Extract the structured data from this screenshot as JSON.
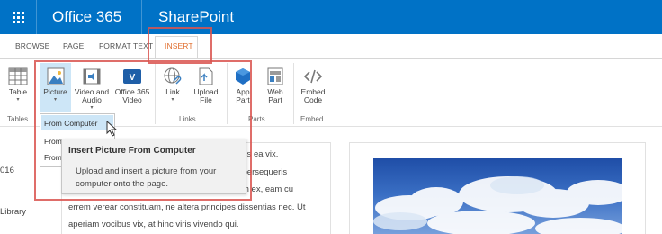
{
  "suite": {
    "app_name": "Office 365",
    "site_name": "SharePoint"
  },
  "tabs": [
    {
      "label": "BROWSE"
    },
    {
      "label": "PAGE"
    },
    {
      "label": "FORMAT TEXT"
    },
    {
      "label": "INSERT"
    }
  ],
  "ribbon": {
    "table": {
      "label": "Table",
      "arrow": "▾"
    },
    "picture": {
      "label": "Picture",
      "arrow": "▾"
    },
    "video_audio": {
      "label1": "Video and",
      "label2": "Audio",
      "arrow": "▾"
    },
    "office365_video": {
      "label1": "Office 365",
      "label2": "Video"
    },
    "link": {
      "label": "Link",
      "arrow": "▾"
    },
    "upload_file": {
      "label1": "Upload",
      "label2": "File"
    },
    "app_part": {
      "label1": "App",
      "label2": "Part"
    },
    "web_part": {
      "label1": "Web",
      "label2": "Part"
    },
    "embed_code": {
      "label1": "Embed",
      "label2": "Code"
    },
    "groups": {
      "tables": "Tables",
      "links": "Links",
      "parts": "Parts",
      "embed": "Embed"
    }
  },
  "dropdown": {
    "items": [
      "From Computer",
      "From",
      "From"
    ]
  },
  "tooltip": {
    "title": "Insert Picture From Computer",
    "body": "Upload and insert a picture from your computer onto the page."
  },
  "leftnav": {
    "item1": "016",
    "item2": "Library"
  },
  "body_text": {
    "line1": "honestatis ea vix.",
    "line2": "labitur persequeris",
    "line3": "ndit cum ex, eam cu",
    "line4": "errem verear constituam, ne altera principes dissentias nec. Ut",
    "line5": "aperiam vocibus vix, at hinc viris vivendo qui."
  },
  "colors": {
    "suite_bar": "#0072c6",
    "insert_tab": "#e06d2d",
    "highlight": "#d9534f",
    "selected": "#cde6f7"
  }
}
